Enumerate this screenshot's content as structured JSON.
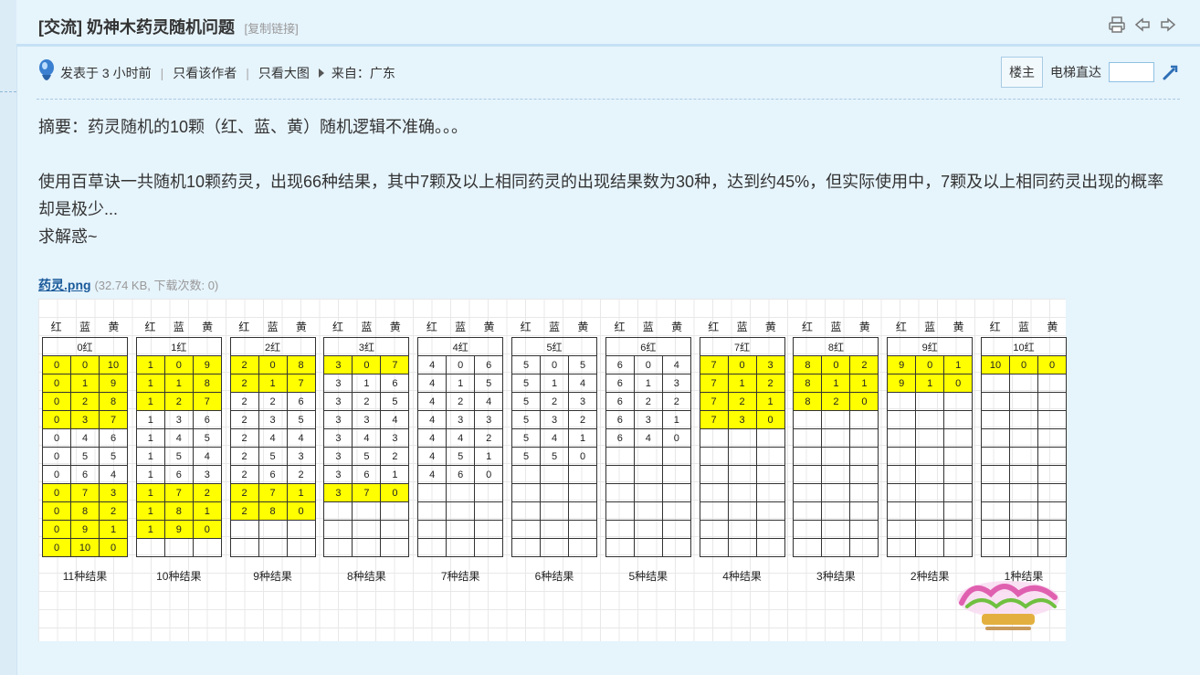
{
  "header": {
    "title": "[交流] 奶神木药灵随机问题",
    "copy_link": "[复制链接]",
    "icons": [
      "print-icon",
      "prev-thread-icon",
      "next-thread-icon"
    ]
  },
  "meta": {
    "posted": "发表于 3 小时前",
    "sep": "|",
    "only_author": "只看该作者",
    "only_big_image": "只看大图",
    "from": "来自：广东",
    "louzhu": "楼主",
    "elevator": "电梯直达",
    "floor_value": ""
  },
  "post": {
    "summary": "摘要：药灵随机的10颗（红、蓝、黄）随机逻辑不准确。。。",
    "body": "使用百草诀一共随机10颗药灵，出现66种结果，其中7颗及以上相同药灵的出现结果数为30种，达到约45%，但实际使用中，7颗及以上相同药灵出现的概率却是极少...",
    "ask": "求解惑~"
  },
  "attachment": {
    "name": "药灵.png",
    "info": "(32.74 KB, 下载次数: 0)"
  },
  "image": {
    "colors": {
      "highlight": "#ffff00",
      "grid": "#e8e8e8"
    },
    "col_headers": [
      "红",
      "蓝",
      "黄"
    ],
    "tables": [
      {
        "caption": "0红",
        "result": "11种结果",
        "rows": [
          [
            "0",
            "0",
            "10"
          ],
          [
            "0",
            "1",
            "9"
          ],
          [
            "0",
            "2",
            "8"
          ],
          [
            "0",
            "3",
            "7"
          ],
          [
            "0",
            "4",
            "6"
          ],
          [
            "0",
            "5",
            "5"
          ],
          [
            "0",
            "6",
            "4"
          ],
          [
            "0",
            "7",
            "3"
          ],
          [
            "0",
            "8",
            "2"
          ],
          [
            "0",
            "9",
            "1"
          ],
          [
            "0",
            "10",
            "0"
          ]
        ],
        "highlight": [
          0,
          1,
          2,
          3,
          7,
          8,
          9,
          10
        ]
      },
      {
        "caption": "1红",
        "result": "10种结果",
        "rows": [
          [
            "1",
            "0",
            "9"
          ],
          [
            "1",
            "1",
            "8"
          ],
          [
            "1",
            "2",
            "7"
          ],
          [
            "1",
            "3",
            "6"
          ],
          [
            "1",
            "4",
            "5"
          ],
          [
            "1",
            "5",
            "4"
          ],
          [
            "1",
            "6",
            "3"
          ],
          [
            "1",
            "7",
            "2"
          ],
          [
            "1",
            "8",
            "1"
          ],
          [
            "1",
            "9",
            "0"
          ]
        ],
        "highlight": [
          0,
          1,
          2,
          7,
          8,
          9
        ]
      },
      {
        "caption": "2红",
        "result": "9种结果",
        "rows": [
          [
            "2",
            "0",
            "8"
          ],
          [
            "2",
            "1",
            "7"
          ],
          [
            "2",
            "2",
            "6"
          ],
          [
            "2",
            "3",
            "5"
          ],
          [
            "2",
            "4",
            "4"
          ],
          [
            "2",
            "5",
            "3"
          ],
          [
            "2",
            "6",
            "2"
          ],
          [
            "2",
            "7",
            "1"
          ],
          [
            "2",
            "8",
            "0"
          ]
        ],
        "highlight": [
          0,
          1,
          7,
          8
        ]
      },
      {
        "caption": "3红",
        "result": "8种结果",
        "rows": [
          [
            "3",
            "0",
            "7"
          ],
          [
            "3",
            "1",
            "6"
          ],
          [
            "3",
            "2",
            "5"
          ],
          [
            "3",
            "3",
            "4"
          ],
          [
            "3",
            "4",
            "3"
          ],
          [
            "3",
            "5",
            "2"
          ],
          [
            "3",
            "6",
            "1"
          ],
          [
            "3",
            "7",
            "0"
          ]
        ],
        "highlight": [
          0,
          7
        ]
      },
      {
        "caption": "4红",
        "result": "7种结果",
        "rows": [
          [
            "4",
            "0",
            "6"
          ],
          [
            "4",
            "1",
            "5"
          ],
          [
            "4",
            "2",
            "4"
          ],
          [
            "4",
            "3",
            "3"
          ],
          [
            "4",
            "4",
            "2"
          ],
          [
            "4",
            "5",
            "1"
          ],
          [
            "4",
            "6",
            "0"
          ]
        ],
        "highlight": []
      },
      {
        "caption": "5红",
        "result": "6种结果",
        "rows": [
          [
            "5",
            "0",
            "5"
          ],
          [
            "5",
            "1",
            "4"
          ],
          [
            "5",
            "2",
            "3"
          ],
          [
            "5",
            "3",
            "2"
          ],
          [
            "5",
            "4",
            "1"
          ],
          [
            "5",
            "5",
            "0"
          ]
        ],
        "highlight": []
      },
      {
        "caption": "6红",
        "result": "5种结果",
        "rows": [
          [
            "6",
            "0",
            "4"
          ],
          [
            "6",
            "1",
            "3"
          ],
          [
            "6",
            "2",
            "2"
          ],
          [
            "6",
            "3",
            "1"
          ],
          [
            "6",
            "4",
            "0"
          ]
        ],
        "highlight": []
      },
      {
        "caption": "7红",
        "result": "4种结果",
        "rows": [
          [
            "7",
            "0",
            "3"
          ],
          [
            "7",
            "1",
            "2"
          ],
          [
            "7",
            "2",
            "1"
          ],
          [
            "7",
            "3",
            "0"
          ]
        ],
        "highlight": [
          0,
          1,
          2,
          3
        ]
      },
      {
        "caption": "8红",
        "result": "3种结果",
        "rows": [
          [
            "8",
            "0",
            "2"
          ],
          [
            "8",
            "1",
            "1"
          ],
          [
            "8",
            "2",
            "0"
          ]
        ],
        "highlight": [
          0,
          1,
          2
        ]
      },
      {
        "caption": "9红",
        "result": "2种结果",
        "rows": [
          [
            "9",
            "0",
            "1"
          ],
          [
            "9",
            "1",
            "0"
          ]
        ],
        "highlight": [
          0,
          1
        ]
      },
      {
        "caption": "10红",
        "result": "1种结果",
        "rows": [
          [
            "10",
            "0",
            "0"
          ]
        ],
        "highlight": [
          0
        ]
      }
    ],
    "watermark": "logo"
  }
}
